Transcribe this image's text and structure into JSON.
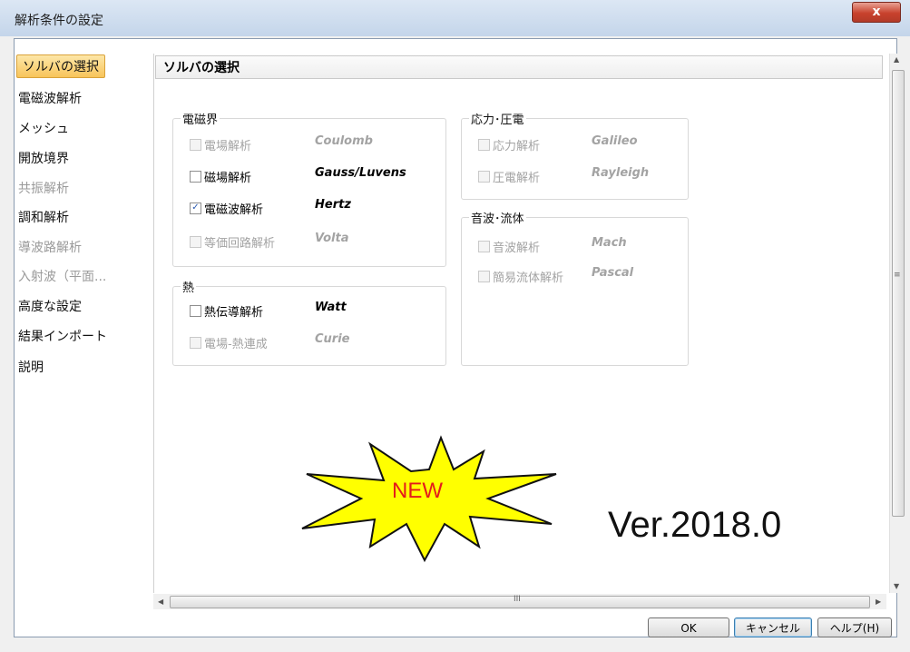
{
  "window": {
    "title": "解析条件の設定",
    "close_label": "x"
  },
  "sidebar": {
    "items": [
      {
        "label": "ソルバの選択",
        "state": "selected"
      },
      {
        "label": "電磁波解析",
        "state": "enabled"
      },
      {
        "label": "メッシュ",
        "state": "enabled"
      },
      {
        "label": "開放境界",
        "state": "enabled"
      },
      {
        "label": "共振解析",
        "state": "disabled"
      },
      {
        "label": "調和解析",
        "state": "enabled"
      },
      {
        "label": "導波路解析",
        "state": "disabled"
      },
      {
        "label": "入射波（平面...",
        "state": "disabled"
      },
      {
        "label": "高度な設定",
        "state": "enabled"
      },
      {
        "label": "結果インポート",
        "state": "enabled"
      },
      {
        "label": "説明",
        "state": "enabled"
      }
    ]
  },
  "section_header": "ソルバの選択",
  "groups": {
    "em": {
      "label": "電磁界",
      "items": [
        {
          "label": "電場解析",
          "solver": "Coulomb",
          "checked": false,
          "enabled": false
        },
        {
          "label": "磁場解析",
          "solver": "Gauss/Luvens",
          "checked": false,
          "enabled": true
        },
        {
          "label": "電磁波解析",
          "solver": "Hertz",
          "checked": true,
          "enabled": true
        },
        {
          "label": "等価回路解析",
          "solver": "Volta",
          "checked": false,
          "enabled": false
        }
      ]
    },
    "heat": {
      "label": "熱",
      "items": [
        {
          "label": "熱伝導解析",
          "solver": "Watt",
          "checked": false,
          "enabled": true
        },
        {
          "label": "電場-熱連成",
          "solver": "Curie",
          "checked": false,
          "enabled": false
        }
      ]
    },
    "stress": {
      "label": "応力･圧電",
      "items": [
        {
          "label": "応力解析",
          "solver": "Galileo",
          "checked": false,
          "enabled": false
        },
        {
          "label": "圧電解析",
          "solver": "Rayleigh",
          "checked": false,
          "enabled": false
        }
      ]
    },
    "acoustic": {
      "label": "音波･流体",
      "items": [
        {
          "label": "音波解析",
          "solver": "Mach",
          "checked": false,
          "enabled": false
        },
        {
          "label": "簡易流体解析",
          "solver": "Pascal",
          "checked": false,
          "enabled": false
        }
      ]
    }
  },
  "overlay": {
    "new_badge": "NEW",
    "version": "Ver.2018.0"
  },
  "scroll": {
    "h_center_mark": "III",
    "v_center_mark": "≡"
  },
  "buttons": {
    "ok": "OK",
    "cancel": "キャンセル",
    "help": "ヘルプ(H)"
  },
  "colors": {
    "accent_selected": "#f8c45a",
    "new_badge_fill": "#ffff00",
    "new_text": "#e41b1b"
  }
}
